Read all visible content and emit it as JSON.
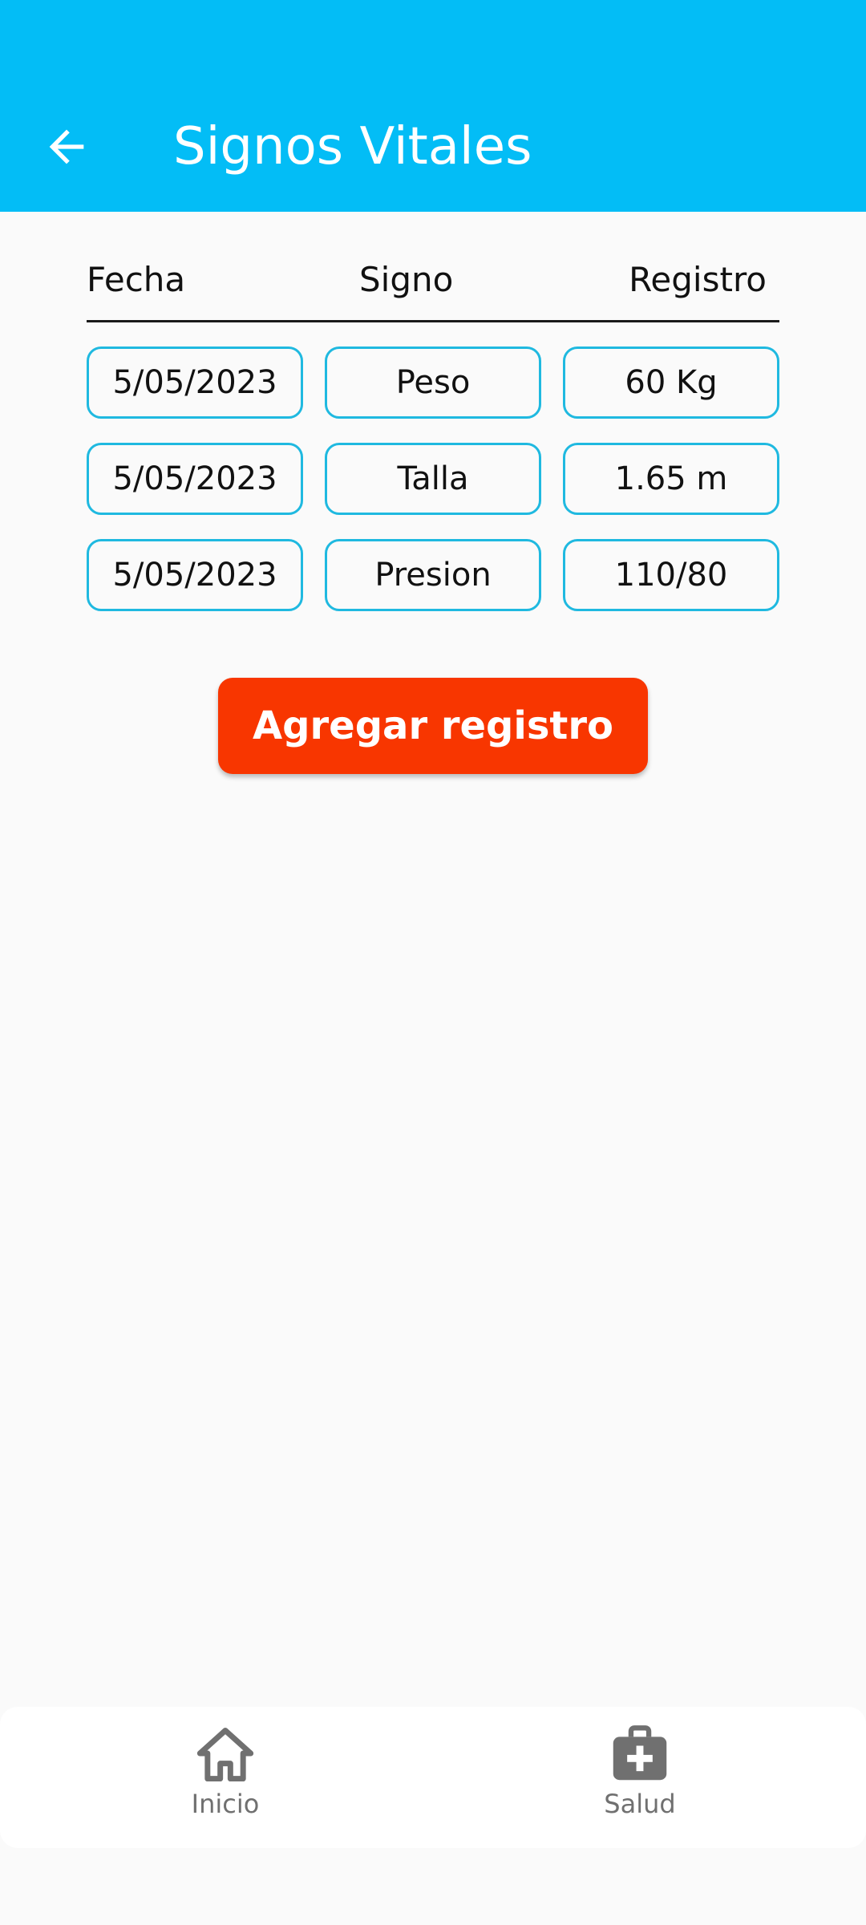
{
  "app_bar": {
    "title": "Signos Vitales",
    "back_icon": "arrow-left-icon",
    "background": "#03bdf6"
  },
  "table": {
    "headers": [
      "Fecha",
      "Signo",
      "Registro"
    ],
    "rows": [
      [
        "5/05/2023",
        "Peso",
        "60 Kg"
      ],
      [
        "5/05/2023",
        "Talla",
        "1.65 m"
      ],
      [
        "5/05/2023",
        "Presion",
        "110/80"
      ]
    ],
    "border_color": "#1fb9e0"
  },
  "actions": {
    "add_label": "Agregar registro",
    "add_color": "#f83600"
  },
  "bottom_nav": {
    "items": [
      {
        "label": "Inicio",
        "icon": "home-icon"
      },
      {
        "label": "Salud",
        "icon": "medical-kit-icon"
      }
    ]
  }
}
